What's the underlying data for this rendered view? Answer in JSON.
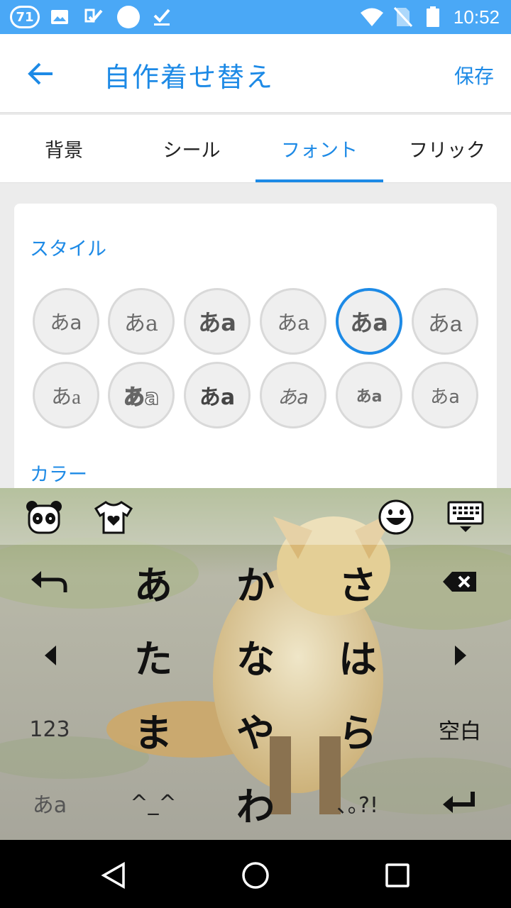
{
  "status_bar": {
    "notification_count": "71",
    "icons": [
      "photo-icon",
      "task-icon",
      "circle-icon",
      "download-done-icon"
    ],
    "system_icons": [
      "wifi-icon",
      "no-sim-icon",
      "battery-icon"
    ],
    "time": "10:52"
  },
  "header": {
    "back_icon": "back-arrow-icon",
    "title": "自作着せ替え",
    "save_label": "保存"
  },
  "tabs": [
    {
      "label": "背景",
      "active": false
    },
    {
      "label": "シール",
      "active": false
    },
    {
      "label": "フォント",
      "active": true
    },
    {
      "label": "フリック",
      "active": false
    }
  ],
  "style_section": {
    "label": "スタイル",
    "font_samples": [
      {
        "text": "あa",
        "selected": false
      },
      {
        "text": "あa",
        "selected": false
      },
      {
        "text": "あa",
        "selected": false
      },
      {
        "text": "あa",
        "selected": false
      },
      {
        "text": "あa",
        "selected": true
      },
      {
        "text": "あa",
        "selected": false
      },
      {
        "text": "あa",
        "selected": false
      },
      {
        "text": "あa",
        "selected": false
      },
      {
        "text": "あa",
        "selected": false
      },
      {
        "text": "あa",
        "selected": false
      },
      {
        "text": "あa",
        "selected": false
      },
      {
        "text": "あa",
        "selected": false
      }
    ]
  },
  "color_section": {
    "label": "カラー"
  },
  "keyboard": {
    "toolbar_icons": [
      "panda-icon",
      "tshirt-heart-icon",
      "smile-emoji-icon",
      "keyboard-hide-icon"
    ],
    "keys": {
      "undo_icon": "undo-arrow-icon",
      "a": "あ",
      "ka": "か",
      "sa": "さ",
      "backspace_icon": "backspace-icon",
      "left_icon": "cursor-left-icon",
      "ta": "た",
      "na": "な",
      "ha": "は",
      "right_icon": "cursor-right-icon",
      "numbers": "123",
      "ma": "ま",
      "ya": "や",
      "ra": "ら",
      "space": "空白",
      "mode": "あa",
      "kaomoji": "^_^",
      "wa": "わ",
      "punct": "､｡?!",
      "enter_icon": "enter-icon"
    }
  },
  "nav_bar": {
    "icons": [
      "nav-back-icon",
      "nav-home-icon",
      "nav-recents-icon"
    ]
  }
}
